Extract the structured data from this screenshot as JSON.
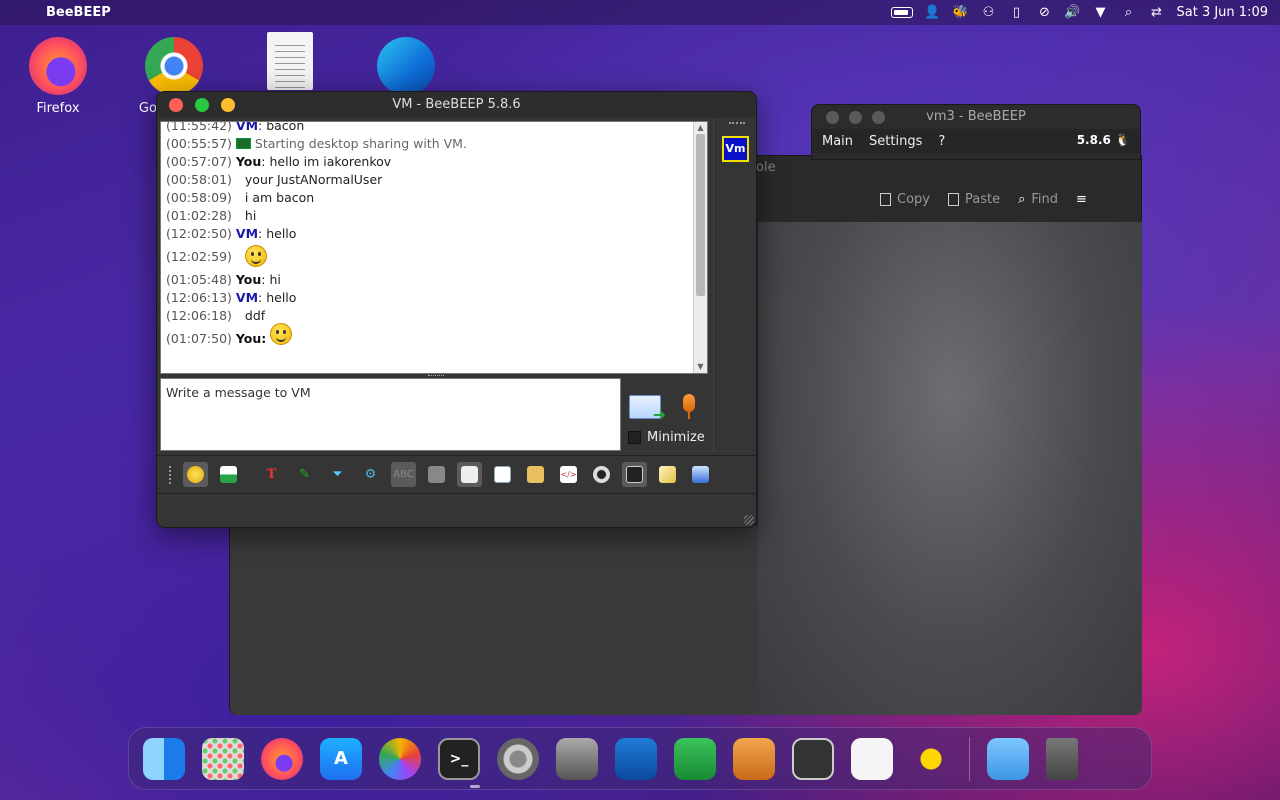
{
  "menubar": {
    "app_name": "BeeBEEP",
    "clock": "Sat 3 Jun 1:09"
  },
  "desktop": {
    "icons": [
      {
        "label": "Firefox"
      },
      {
        "label": "Goog"
      },
      {
        "label": ""
      },
      {
        "label": ""
      }
    ]
  },
  "back_window": {
    "title": "vm3 - BeeBEEP",
    "menu": [
      "Main",
      "Settings",
      "?"
    ],
    "version": "5.8.6"
  },
  "konsole": {
    "title_fragment": "ole",
    "toolbar": {
      "copy": "Copy",
      "paste": "Paste",
      "find": "Find"
    }
  },
  "main_window": {
    "title": "VM - BeeBEEP 5.8.6",
    "chat": [
      {
        "time": "(11:55:42)",
        "who": "VM",
        "text": ": bacon"
      },
      {
        "time": "(00:55:57)",
        "sys": "Starting desktop sharing with VM."
      },
      {
        "time": "(00:57:07)",
        "who": "You",
        "text": ": hello im iakorenkov"
      },
      {
        "time": "(00:58:01)",
        "text": "your JustANormalUser"
      },
      {
        "time": "(00:58:09)",
        "text": "i am bacon"
      },
      {
        "time": "(01:02:28)",
        "text": "hi"
      },
      {
        "time": "(12:02:50)",
        "who": "VM",
        "text": ": hello"
      },
      {
        "time": "(12:02:59)",
        "emoji": "smile-emoji"
      },
      {
        "time": "(01:05:48)",
        "who": "You",
        "text": ": hi"
      },
      {
        "time": "(12:06:13)",
        "who": "VM",
        "text": ": hello"
      },
      {
        "time": "(12:06:18)",
        "text": "ddf"
      },
      {
        "time": "(01:07:50)",
        "who": "You",
        "text": ":",
        "emoji": "smirk-emoji"
      }
    ],
    "input_placeholder": "Write a message to VM",
    "minimize_label": "Minimize",
    "user_badge": "Vm"
  },
  "colors": {
    "accent_vm": "#1a1aa8",
    "badge_bg": "#0a10c8",
    "badge_border": "#f0e100"
  }
}
